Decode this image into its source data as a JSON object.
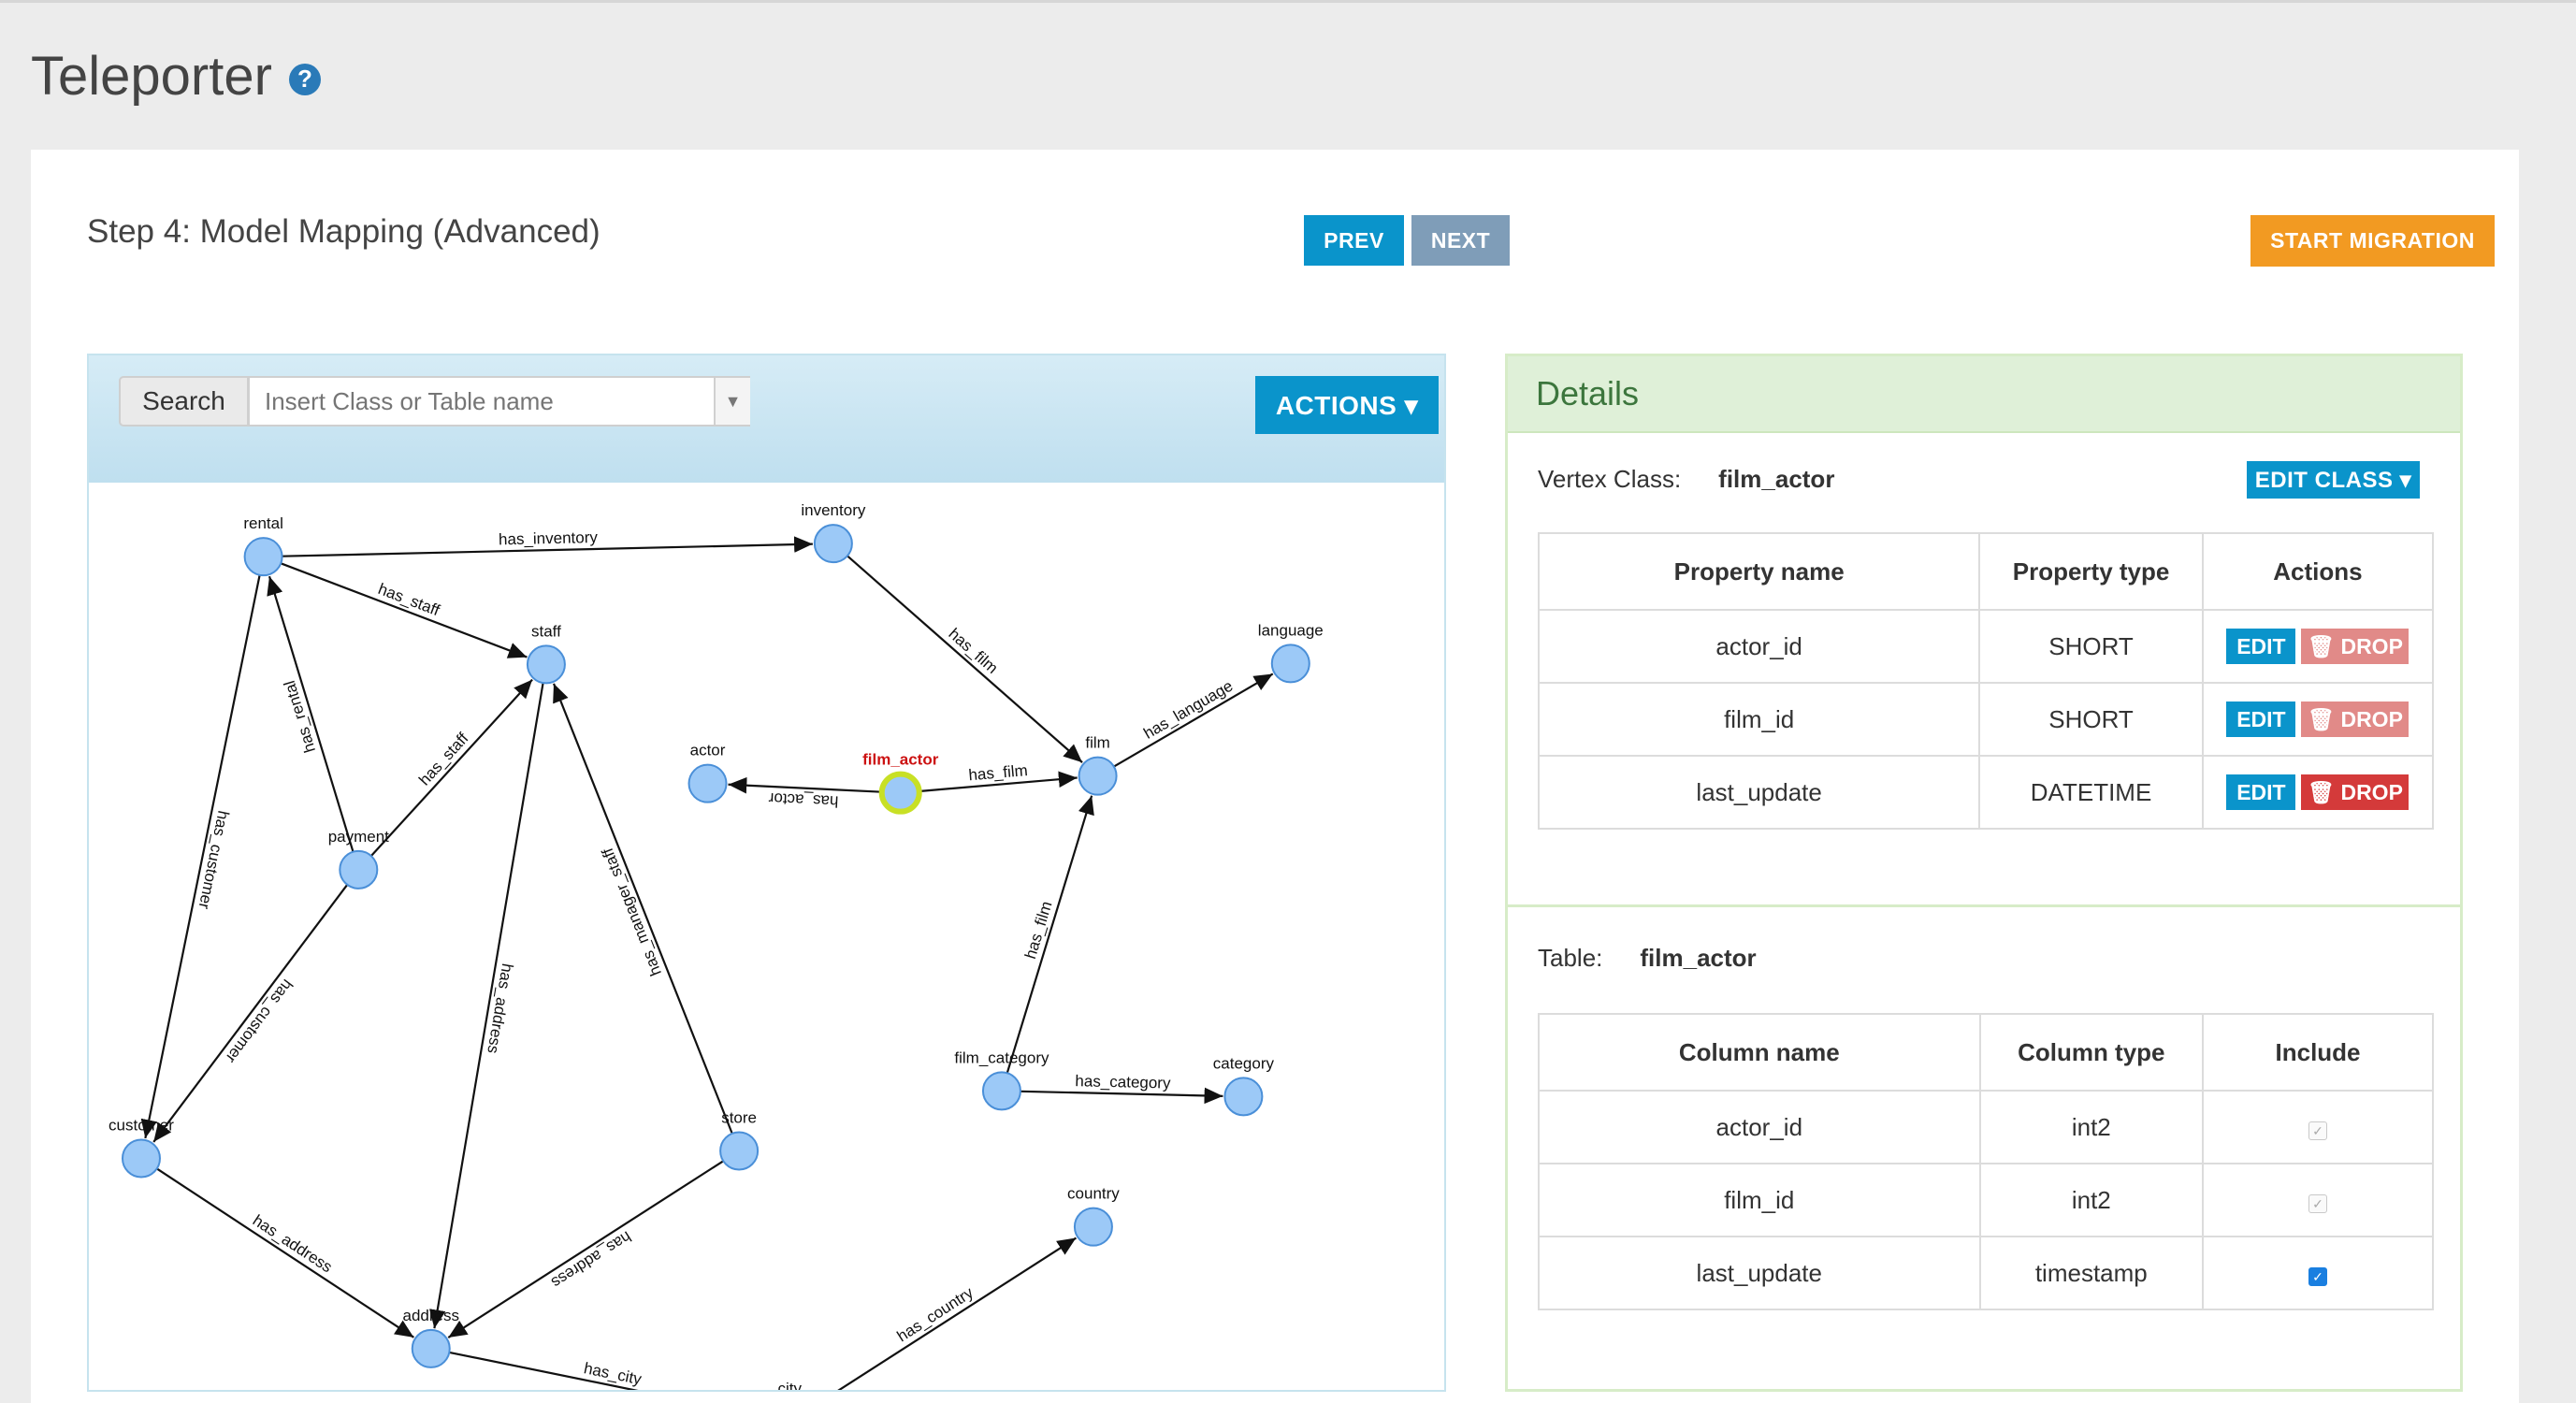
{
  "app": {
    "title": "Teleporter",
    "help_icon": "help-icon"
  },
  "step": {
    "title": "Step 4: Model Mapping (Advanced)",
    "prev_label": "PREV",
    "next_label": "NEXT",
    "start_label": "START MIGRATION"
  },
  "search": {
    "label": "Search",
    "placeholder": "Insert Class or Table name"
  },
  "actions_label": "ACTIONS ▾",
  "graph": {
    "selected": "film_actor",
    "nodes": [
      {
        "id": "rental",
        "label": "rental"
      },
      {
        "id": "inventory",
        "label": "inventory"
      },
      {
        "id": "staff",
        "label": "staff"
      },
      {
        "id": "language",
        "label": "language"
      },
      {
        "id": "actor",
        "label": "actor"
      },
      {
        "id": "film_actor",
        "label": "film_actor"
      },
      {
        "id": "film",
        "label": "film"
      },
      {
        "id": "payment",
        "label": "payment"
      },
      {
        "id": "film_category",
        "label": "film_category"
      },
      {
        "id": "category",
        "label": "category"
      },
      {
        "id": "customer",
        "label": "customer"
      },
      {
        "id": "store",
        "label": "store"
      },
      {
        "id": "country",
        "label": "country"
      },
      {
        "id": "address",
        "label": "address"
      },
      {
        "id": "city",
        "label": "city"
      }
    ],
    "edges": [
      {
        "from": "rental",
        "to": "inventory",
        "label": "has_inventory"
      },
      {
        "from": "rental",
        "to": "staff",
        "label": "has_staff"
      },
      {
        "from": "rental",
        "to": "customer",
        "label": "has_customer"
      },
      {
        "from": "payment",
        "to": "rental",
        "label": "has_rental"
      },
      {
        "from": "payment",
        "to": "staff",
        "label": "has_staff"
      },
      {
        "from": "payment",
        "to": "customer",
        "label": "has_customer"
      },
      {
        "from": "inventory",
        "to": "film",
        "label": "has_film"
      },
      {
        "from": "film",
        "to": "language",
        "label": "has_language"
      },
      {
        "from": "film_actor",
        "to": "film",
        "label": "has_film"
      },
      {
        "from": "film_actor",
        "to": "actor",
        "label": "has_actor"
      },
      {
        "from": "film_category",
        "to": "film",
        "label": "has_film"
      },
      {
        "from": "film_category",
        "to": "category",
        "label": "has_category"
      },
      {
        "from": "store",
        "to": "staff",
        "label": "has_manager_staff"
      },
      {
        "from": "staff",
        "to": "address",
        "label": "has_address"
      },
      {
        "from": "store",
        "to": "address",
        "label": "has_address"
      },
      {
        "from": "customer",
        "to": "address",
        "label": "has_address"
      },
      {
        "from": "address",
        "to": "city",
        "label": "has_city"
      },
      {
        "from": "city",
        "to": "country",
        "label": "has_country"
      }
    ]
  },
  "details": {
    "title": "Details",
    "vertex_label": "Vertex Class:",
    "vertex_value": "film_actor",
    "edit_class_label": "EDIT CLASS ▾",
    "property_headers": [
      "Property name",
      "Property type",
      "Actions"
    ],
    "properties": [
      {
        "name": "actor_id",
        "type": "SHORT"
      },
      {
        "name": "film_id",
        "type": "SHORT"
      },
      {
        "name": "last_update",
        "type": "DATETIME"
      }
    ],
    "edit_label": "EDIT",
    "drop_label": "DROP",
    "table_label": "Table:",
    "table_value": "film_actor",
    "column_headers": [
      "Column name",
      "Column type",
      "Include"
    ],
    "columns": [
      {
        "name": "actor_id",
        "type": "int2",
        "include": true
      },
      {
        "name": "film_id",
        "type": "int2",
        "include": true
      },
      {
        "name": "last_update",
        "type": "timestamp",
        "include": true
      }
    ]
  },
  "colors": {
    "primary": "#0a94cb",
    "next": "#7f9db8",
    "start": "#f29a22",
    "drop_light": "#e18a88",
    "drop_strong": "#d43a3a",
    "node_fill": "#9cc9f7",
    "node_stroke": "#4a8fd8",
    "selected_ring": "#c8e025",
    "selected_label": "#cc1111"
  }
}
